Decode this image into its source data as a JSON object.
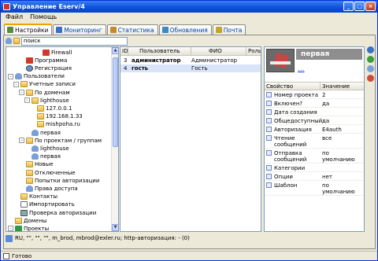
{
  "window": {
    "title": "Управление Eserv/4"
  },
  "menu": [
    "Файл",
    "Помощь"
  ],
  "tabs": [
    {
      "label": "Настройки",
      "active": true,
      "icon": "settings-icon",
      "color": "#5a8a3a"
    },
    {
      "label": "Мониторинг",
      "active": false,
      "icon": "monitor-icon",
      "color": "#3a6fc4"
    },
    {
      "label": "Статистика",
      "active": false,
      "icon": "statistics-icon",
      "color": "#c48a2a"
    },
    {
      "label": "Обновления",
      "active": false,
      "icon": "update-icon",
      "color": "#3a8ac4"
    },
    {
      "label": "Почта",
      "active": false,
      "icon": "mail-icon",
      "color": "#c4a42a"
    }
  ],
  "search": {
    "value": "поиск"
  },
  "tree": [
    {
      "label": "Firewall",
      "indent": 5,
      "icon": "firewall-icon",
      "kind": "red",
      "exp": ""
    },
    {
      "label": "Программа",
      "indent": 2,
      "icon": "program-icon",
      "kind": "red",
      "exp": ""
    },
    {
      "label": "Регистрация",
      "indent": 2,
      "icon": "registration-icon",
      "kind": "gear",
      "exp": ""
    },
    {
      "label": "Пользователи",
      "indent": 0,
      "icon": "users-icon",
      "kind": "user",
      "exp": "-"
    },
    {
      "label": "Учетные записи",
      "indent": 1,
      "icon": "accounts-icon",
      "kind": "folder",
      "exp": "-"
    },
    {
      "label": "По доменам",
      "indent": 2,
      "icon": "folder-icon",
      "kind": "folder",
      "exp": "-"
    },
    {
      "label": "lighthouse",
      "indent": 3,
      "icon": "folder-icon",
      "kind": "folder",
      "exp": "-"
    },
    {
      "label": "127.0.0.1",
      "indent": 4,
      "icon": "folder-icon",
      "kind": "folder",
      "exp": ""
    },
    {
      "label": "192.168.1.33",
      "indent": 4,
      "icon": "folder-icon",
      "kind": "folder",
      "exp": ""
    },
    {
      "label": "mishpoha.ru",
      "indent": 4,
      "icon": "folder-icon",
      "kind": "folder",
      "exp": ""
    },
    {
      "label": "первая",
      "indent": 3,
      "icon": "user-icon",
      "kind": "user",
      "exp": ""
    },
    {
      "label": "По проектам / группам",
      "indent": 2,
      "icon": "folder-icon",
      "kind": "folder",
      "exp": "-"
    },
    {
      "label": "lighthouse",
      "indent": 3,
      "icon": "user-icon",
      "kind": "user",
      "exp": ""
    },
    {
      "label": "первая",
      "indent": 3,
      "icon": "user-icon",
      "kind": "user",
      "exp": ""
    },
    {
      "label": "Новые",
      "indent": 2,
      "icon": "folder-icon",
      "kind": "folder",
      "exp": ""
    },
    {
      "label": "Отключенные",
      "indent": 2,
      "icon": "folder-icon",
      "kind": "folder",
      "exp": ""
    },
    {
      "label": "Попытки авторизации",
      "indent": 2,
      "icon": "folder-icon",
      "kind": "folder",
      "exp": ""
    },
    {
      "label": "Права доступа",
      "indent": 2,
      "icon": "access-rights-icon",
      "kind": "user",
      "exp": ""
    },
    {
      "label": "Контакты",
      "indent": 1,
      "icon": "contacts-icon",
      "kind": "folder",
      "exp": ""
    },
    {
      "label": "Импортировать",
      "indent": 1,
      "icon": "import-icon",
      "kind": "doc",
      "exp": ""
    },
    {
      "label": "Проверка авторизации",
      "indent": 1,
      "icon": "auth-check-icon",
      "kind": "comp",
      "exp": ""
    },
    {
      "label": "Домены",
      "indent": 0,
      "icon": "domains-icon",
      "kind": "folder",
      "exp": ""
    },
    {
      "label": "Проекты",
      "indent": 0,
      "icon": "projects-icon",
      "kind": "green",
      "exp": "-"
    },
    {
      "label": "lighthouse",
      "indent": 1,
      "icon": "project-icon",
      "kind": "green",
      "exp": ""
    }
  ],
  "grid": {
    "columns": [
      "ID",
      "Пользователь",
      "ФИО",
      "Роль"
    ],
    "rows": [
      {
        "id": "3",
        "user": "администратор",
        "fio": "Администратор",
        "role": ""
      },
      {
        "id": "4",
        "user": "гость",
        "fio": "Гость",
        "role": ""
      }
    ]
  },
  "profile": {
    "name": "первая",
    "link": "..."
  },
  "props": {
    "columns": [
      "Свойство",
      "Значение"
    ],
    "rows": [
      {
        "name": "Номер проекта",
        "value": "2"
      },
      {
        "name": "Включен?",
        "value": "да"
      },
      {
        "name": "Дата создания",
        "value": ""
      },
      {
        "name": "Общедоступный",
        "value": "да"
      },
      {
        "name": "Авторизация",
        "value": "E4auth"
      },
      {
        "name": "Чтение сообщений",
        "value": "все"
      },
      {
        "name": "Отправка сообщений",
        "value": "по умолчанию"
      },
      {
        "name": "Категории",
        "value": ""
      },
      {
        "name": "Опции",
        "value": "нет"
      },
      {
        "name": "Шаблон",
        "value": "по умолчанию"
      }
    ]
  },
  "bottom": {
    "text": "RU, \"\", \"\", \"\", m_brod, mbrod@exler.ru; http-авторизация: - (0)"
  },
  "status": {
    "text": "Готово"
  },
  "colors": {
    "accent": "#0a4fd8",
    "tab_active": "#f0a000",
    "selection": "#d9e4f8"
  }
}
